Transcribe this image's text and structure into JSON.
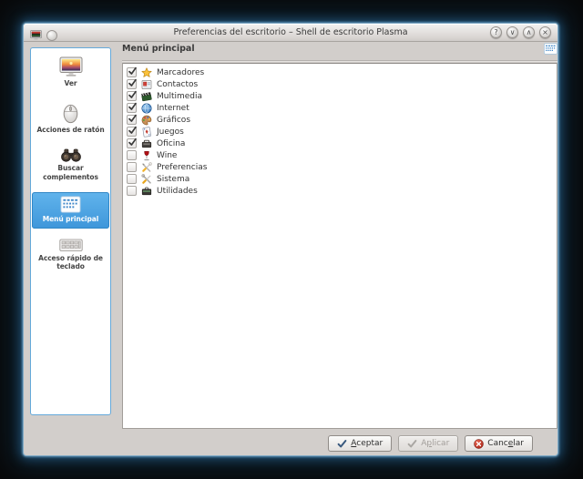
{
  "window": {
    "title": "Preferencias del escritorio – Shell de escritorio Plasma",
    "controls": [
      {
        "name": "help",
        "glyph": "?"
      },
      {
        "name": "minimize",
        "glyph": "∨"
      },
      {
        "name": "maximize",
        "glyph": "∧"
      },
      {
        "name": "close",
        "glyph": "×"
      }
    ]
  },
  "sidebar": {
    "items": [
      {
        "id": "ver",
        "label": "Ver",
        "icon": "monitor-icon",
        "selected": false
      },
      {
        "id": "acciones-de-raton",
        "label": "Acciones de ratón",
        "icon": "mouse-icon",
        "selected": false
      },
      {
        "id": "buscar-complementos",
        "label": "Buscar complementos",
        "icon": "binoculars-icon",
        "selected": false
      },
      {
        "id": "menu-principal",
        "label": "Menú principal",
        "icon": "menu-grid-icon",
        "selected": true
      },
      {
        "id": "acceso-rapido-de-teclado",
        "label": "Acceso rápido de teclado",
        "icon": "keyboard-icon",
        "selected": false
      }
    ]
  },
  "main": {
    "title": "Menú principal",
    "items": [
      {
        "label": "Marcadores",
        "icon": "star-icon",
        "checked": true
      },
      {
        "label": "Contactos",
        "icon": "contacts-icon",
        "checked": true
      },
      {
        "label": "Multimedia",
        "icon": "multimedia-icon",
        "checked": true
      },
      {
        "label": "Internet",
        "icon": "internet-icon",
        "checked": true
      },
      {
        "label": "Gráficos",
        "icon": "graphics-icon",
        "checked": true
      },
      {
        "label": "Juegos",
        "icon": "games-icon",
        "checked": true
      },
      {
        "label": "Oficina",
        "icon": "office-icon",
        "checked": true
      },
      {
        "label": "Wine",
        "icon": "wine-icon",
        "checked": false
      },
      {
        "label": "Preferencias",
        "icon": "preferences-icon",
        "checked": false
      },
      {
        "label": "Sistema",
        "icon": "system-icon",
        "checked": false
      },
      {
        "label": "Utilidades",
        "icon": "utilities-icon",
        "checked": false
      }
    ]
  },
  "footer": {
    "accept": {
      "pre": "",
      "key": "A",
      "post": "ceptar"
    },
    "apply": {
      "pre": "A",
      "key": "p",
      "post": "licar"
    },
    "cancel": {
      "pre": "Canc",
      "key": "e",
      "post": "lar"
    }
  },
  "colors": {
    "selection_blue": "#3f9ddd",
    "window_bg": "#d2cecb",
    "accept_check": "#39597e",
    "cancel_red": "#b01d12"
  }
}
